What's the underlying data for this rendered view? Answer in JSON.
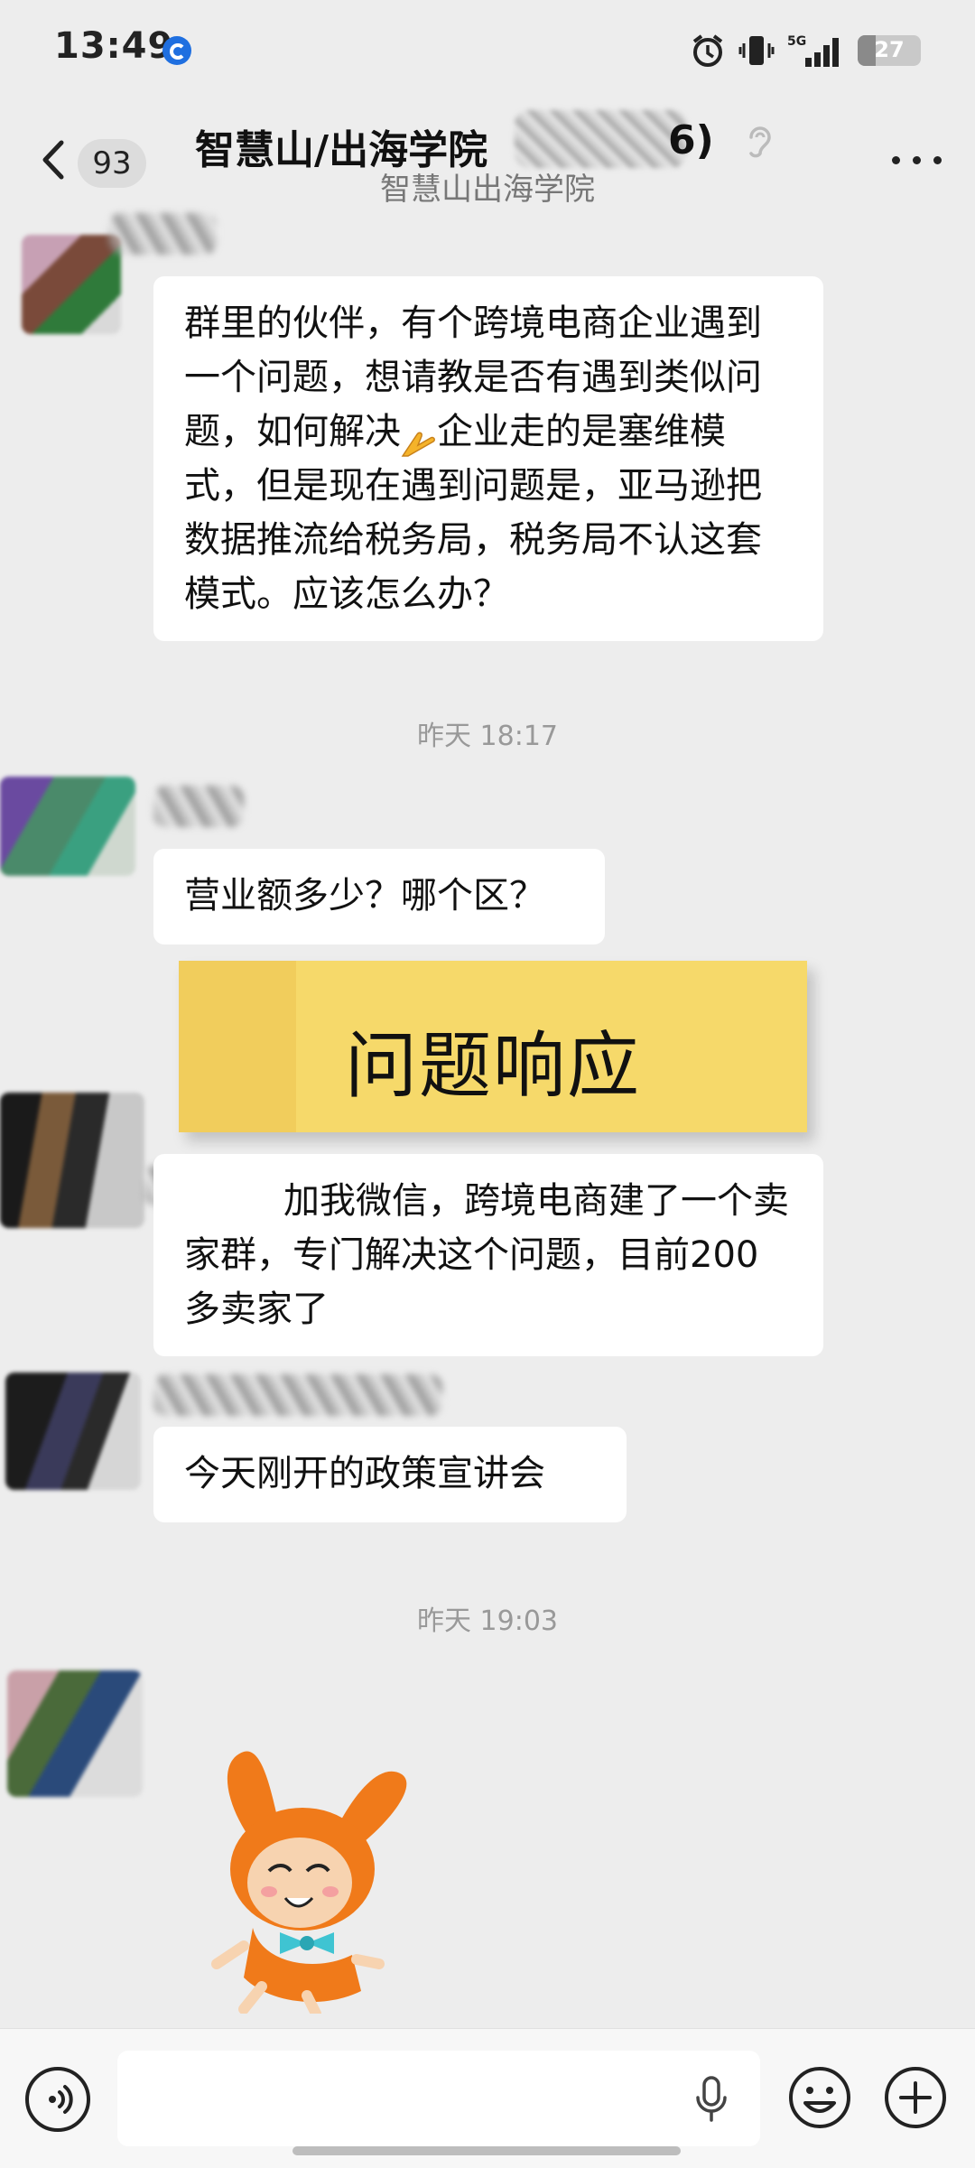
{
  "status_bar": {
    "time": "13:49",
    "network": "5G",
    "battery": "27",
    "icons": [
      "app-notification-icon",
      "alarm-icon",
      "vibrate-icon",
      "signal-5g-icon",
      "battery-icon"
    ]
  },
  "header": {
    "unread_count": "93",
    "title": "智慧山/出海学院",
    "title_tail": "6)",
    "subtitle": "智慧山出海学院",
    "icons": [
      "back-icon",
      "ear-icon",
      "more-icon"
    ]
  },
  "messages": [
    {
      "id": "m1",
      "text_before_emoji": "群里的伙伴，有个跨境电商企业遇到一个问题，想请教是否有遇到类似问题，如何解决",
      "emoji": "praying-hands-emoji",
      "text_after_emoji": "企业走的是塞维模式，但是现在遇到问题是，亚马逊把数据推流给税务局，税务局不认这套模式。应该怎么办？"
    },
    {
      "id": "m2",
      "text": "营业额多少？哪个区？"
    },
    {
      "id": "m3",
      "text": "加我微信，跨境电商建了一个卖家群，专门解决这个问题，目前200多卖家了"
    },
    {
      "id": "m4",
      "text": "今天刚开的政策宣讲会"
    }
  ],
  "time_separators": [
    "昨天 18:17",
    "昨天 19:03"
  ],
  "overlay": {
    "sticky_note_text": "问题响应"
  },
  "sticker": {
    "name": "orange-bunny-sticker"
  },
  "input_bar": {
    "placeholder": "",
    "icons": [
      "voice-icon",
      "mic-icon",
      "emoji-icon",
      "plus-icon"
    ]
  },
  "colors": {
    "background": "#ededed",
    "bubble": "#ffffff",
    "sticky_note": "#f6d96a",
    "time_text": "#999999"
  }
}
